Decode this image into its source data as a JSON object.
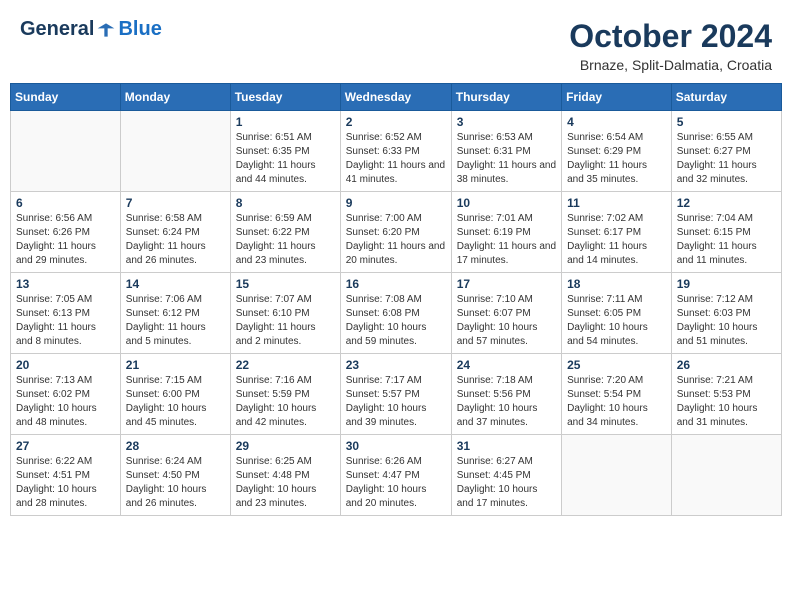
{
  "header": {
    "logo": {
      "text_general": "General",
      "text_blue": "Blue"
    },
    "title": "October 2024",
    "subtitle": "Brnaze, Split-Dalmatia, Croatia"
  },
  "weekdays": [
    "Sunday",
    "Monday",
    "Tuesday",
    "Wednesday",
    "Thursday",
    "Friday",
    "Saturday"
  ],
  "weeks": [
    [
      {
        "day": "",
        "detail": ""
      },
      {
        "day": "",
        "detail": ""
      },
      {
        "day": "1",
        "detail": "Sunrise: 6:51 AM\nSunset: 6:35 PM\nDaylight: 11 hours and 44 minutes."
      },
      {
        "day": "2",
        "detail": "Sunrise: 6:52 AM\nSunset: 6:33 PM\nDaylight: 11 hours and 41 minutes."
      },
      {
        "day": "3",
        "detail": "Sunrise: 6:53 AM\nSunset: 6:31 PM\nDaylight: 11 hours and 38 minutes."
      },
      {
        "day": "4",
        "detail": "Sunrise: 6:54 AM\nSunset: 6:29 PM\nDaylight: 11 hours and 35 minutes."
      },
      {
        "day": "5",
        "detail": "Sunrise: 6:55 AM\nSunset: 6:27 PM\nDaylight: 11 hours and 32 minutes."
      }
    ],
    [
      {
        "day": "6",
        "detail": "Sunrise: 6:56 AM\nSunset: 6:26 PM\nDaylight: 11 hours and 29 minutes."
      },
      {
        "day": "7",
        "detail": "Sunrise: 6:58 AM\nSunset: 6:24 PM\nDaylight: 11 hours and 26 minutes."
      },
      {
        "day": "8",
        "detail": "Sunrise: 6:59 AM\nSunset: 6:22 PM\nDaylight: 11 hours and 23 minutes."
      },
      {
        "day": "9",
        "detail": "Sunrise: 7:00 AM\nSunset: 6:20 PM\nDaylight: 11 hours and 20 minutes."
      },
      {
        "day": "10",
        "detail": "Sunrise: 7:01 AM\nSunset: 6:19 PM\nDaylight: 11 hours and 17 minutes."
      },
      {
        "day": "11",
        "detail": "Sunrise: 7:02 AM\nSunset: 6:17 PM\nDaylight: 11 hours and 14 minutes."
      },
      {
        "day": "12",
        "detail": "Sunrise: 7:04 AM\nSunset: 6:15 PM\nDaylight: 11 hours and 11 minutes."
      }
    ],
    [
      {
        "day": "13",
        "detail": "Sunrise: 7:05 AM\nSunset: 6:13 PM\nDaylight: 11 hours and 8 minutes."
      },
      {
        "day": "14",
        "detail": "Sunrise: 7:06 AM\nSunset: 6:12 PM\nDaylight: 11 hours and 5 minutes."
      },
      {
        "day": "15",
        "detail": "Sunrise: 7:07 AM\nSunset: 6:10 PM\nDaylight: 11 hours and 2 minutes."
      },
      {
        "day": "16",
        "detail": "Sunrise: 7:08 AM\nSunset: 6:08 PM\nDaylight: 10 hours and 59 minutes."
      },
      {
        "day": "17",
        "detail": "Sunrise: 7:10 AM\nSunset: 6:07 PM\nDaylight: 10 hours and 57 minutes."
      },
      {
        "day": "18",
        "detail": "Sunrise: 7:11 AM\nSunset: 6:05 PM\nDaylight: 10 hours and 54 minutes."
      },
      {
        "day": "19",
        "detail": "Sunrise: 7:12 AM\nSunset: 6:03 PM\nDaylight: 10 hours and 51 minutes."
      }
    ],
    [
      {
        "day": "20",
        "detail": "Sunrise: 7:13 AM\nSunset: 6:02 PM\nDaylight: 10 hours and 48 minutes."
      },
      {
        "day": "21",
        "detail": "Sunrise: 7:15 AM\nSunset: 6:00 PM\nDaylight: 10 hours and 45 minutes."
      },
      {
        "day": "22",
        "detail": "Sunrise: 7:16 AM\nSunset: 5:59 PM\nDaylight: 10 hours and 42 minutes."
      },
      {
        "day": "23",
        "detail": "Sunrise: 7:17 AM\nSunset: 5:57 PM\nDaylight: 10 hours and 39 minutes."
      },
      {
        "day": "24",
        "detail": "Sunrise: 7:18 AM\nSunset: 5:56 PM\nDaylight: 10 hours and 37 minutes."
      },
      {
        "day": "25",
        "detail": "Sunrise: 7:20 AM\nSunset: 5:54 PM\nDaylight: 10 hours and 34 minutes."
      },
      {
        "day": "26",
        "detail": "Sunrise: 7:21 AM\nSunset: 5:53 PM\nDaylight: 10 hours and 31 minutes."
      }
    ],
    [
      {
        "day": "27",
        "detail": "Sunrise: 6:22 AM\nSunset: 4:51 PM\nDaylight: 10 hours and 28 minutes."
      },
      {
        "day": "28",
        "detail": "Sunrise: 6:24 AM\nSunset: 4:50 PM\nDaylight: 10 hours and 26 minutes."
      },
      {
        "day": "29",
        "detail": "Sunrise: 6:25 AM\nSunset: 4:48 PM\nDaylight: 10 hours and 23 minutes."
      },
      {
        "day": "30",
        "detail": "Sunrise: 6:26 AM\nSunset: 4:47 PM\nDaylight: 10 hours and 20 minutes."
      },
      {
        "day": "31",
        "detail": "Sunrise: 6:27 AM\nSunset: 4:45 PM\nDaylight: 10 hours and 17 minutes."
      },
      {
        "day": "",
        "detail": ""
      },
      {
        "day": "",
        "detail": ""
      }
    ]
  ]
}
